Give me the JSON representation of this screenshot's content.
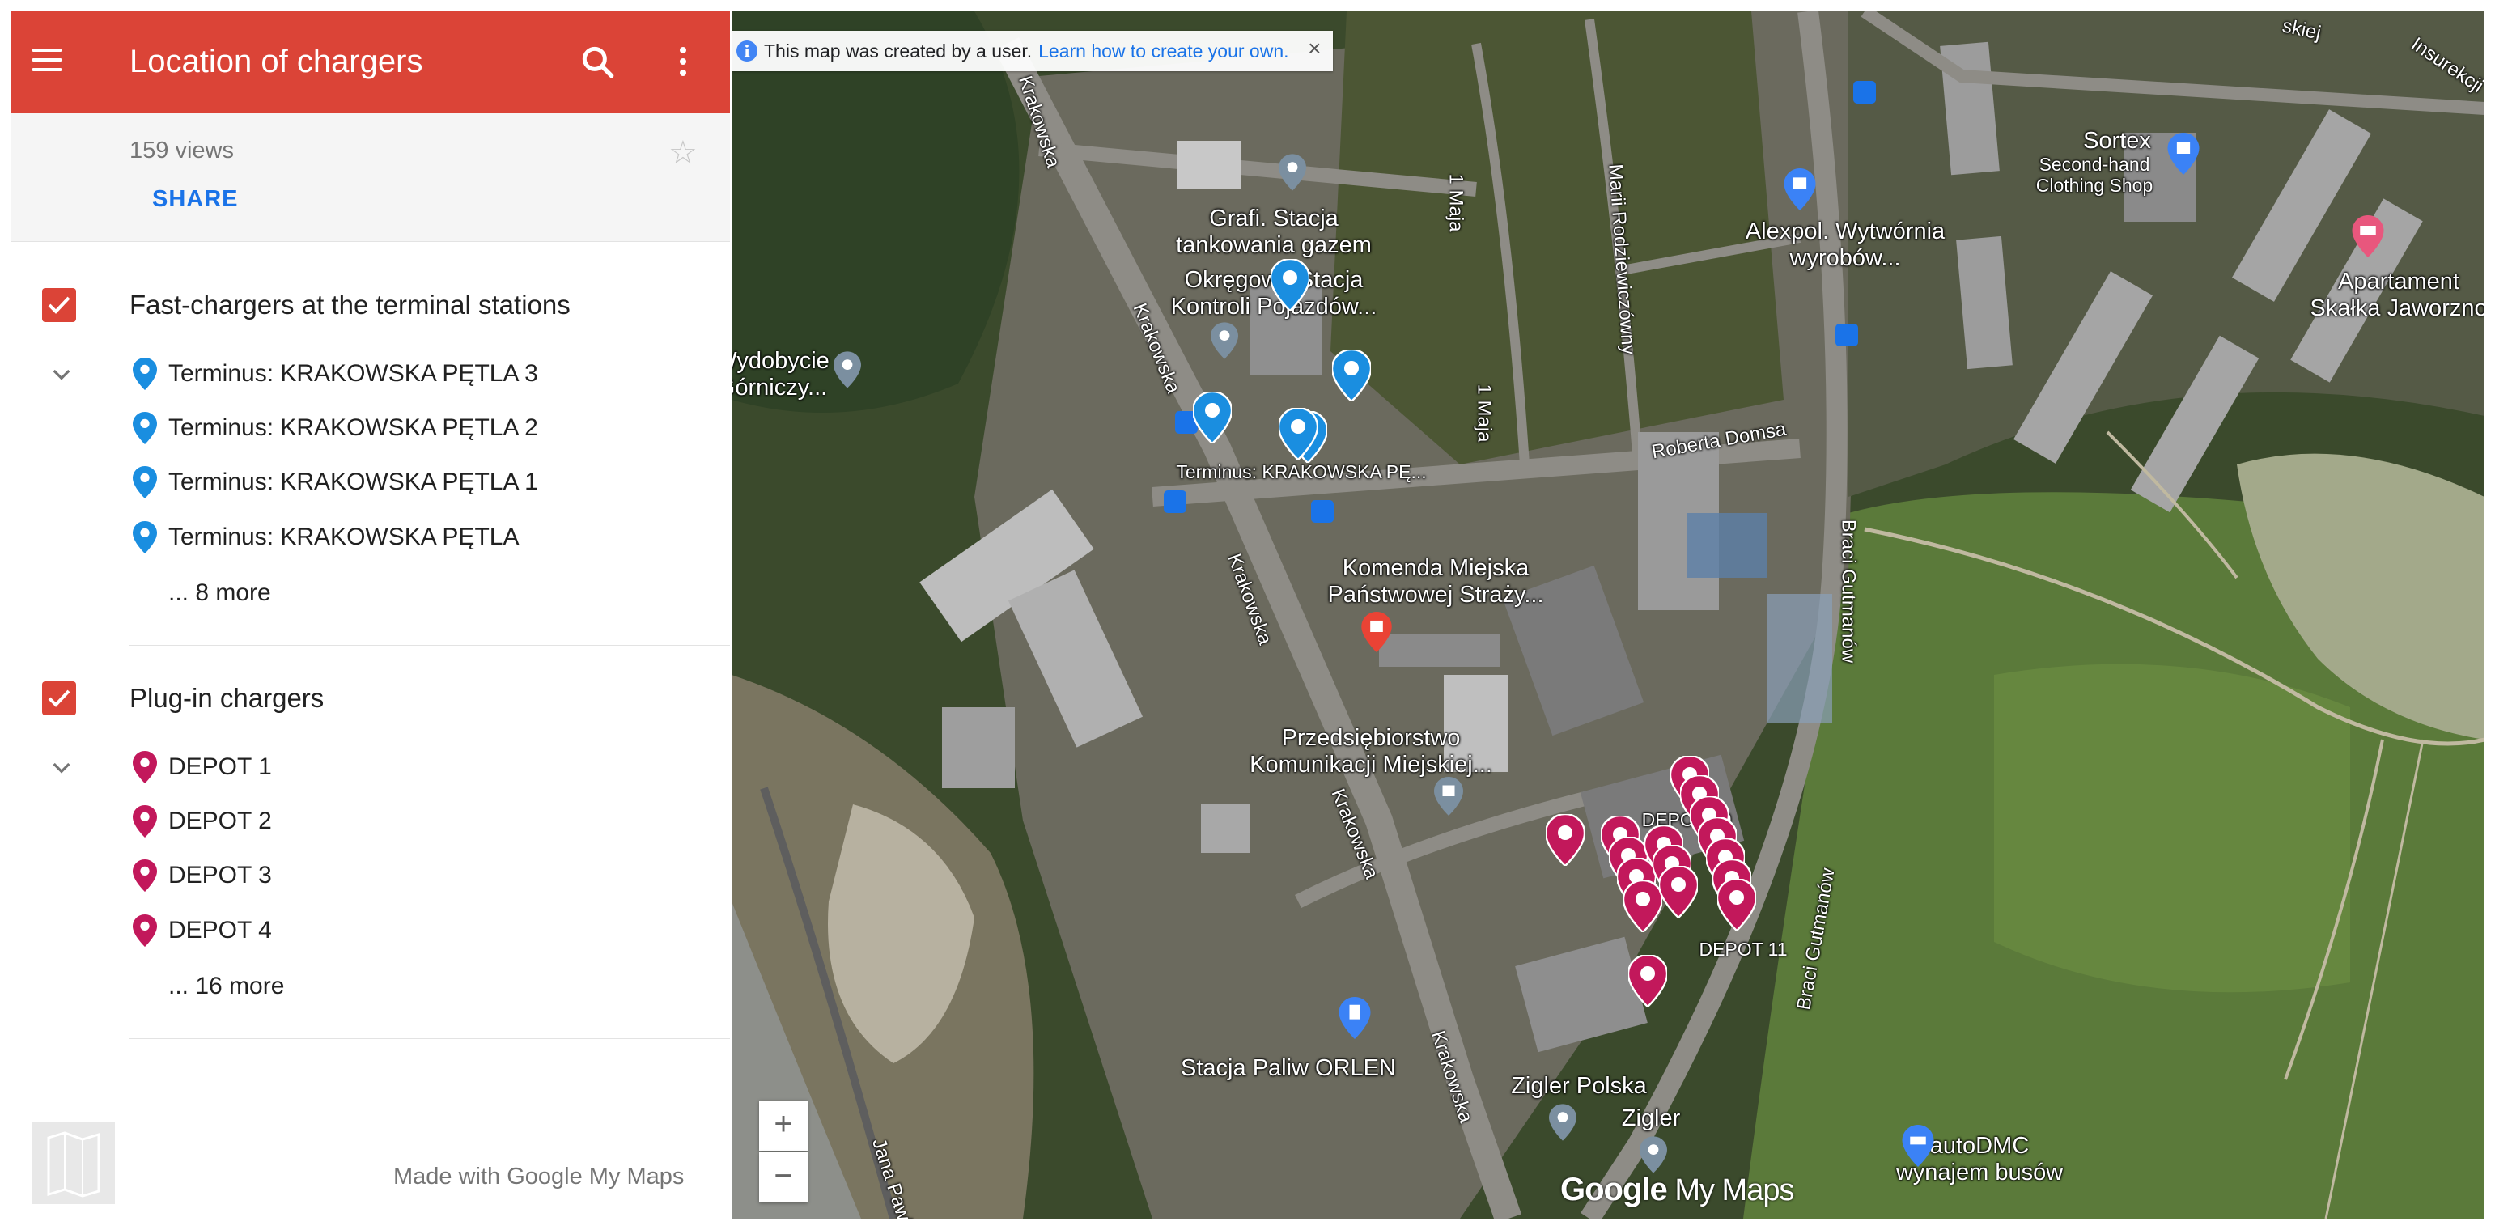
{
  "sidebar": {
    "title": "Location of chargers",
    "views": "159 views",
    "share": "SHARE",
    "layers": [
      {
        "name": "Fast-chargers at the terminal stations",
        "pin_color": "#1a8ee0",
        "items": [
          "Terminus: KRAKOWSKA PĘTLA 3",
          "Terminus: KRAKOWSKA PĘTLA 2",
          "Terminus: KRAKOWSKA PĘTLA 1",
          "Terminus: KRAKOWSKA PĘTLA"
        ],
        "more": "... 8 more"
      },
      {
        "name": "Plug-in chargers",
        "pin_color": "#c2185b",
        "items": [
          "DEPOT 1",
          "DEPOT 2",
          "DEPOT 3",
          "DEPOT 4"
        ],
        "more": "... 16 more"
      }
    ],
    "footer": "Made with Google My Maps",
    "check_color": "#db4437"
  },
  "map": {
    "banner": {
      "text": "This map was created by a user.",
      "link": "Learn how to create your own.",
      "close": "×"
    },
    "place_labels": {
      "grafi": "Grafi. Stacja\ntankowania gazem",
      "okregowa": "Okręgowa Stacja\nKontroli Pojazdów...",
      "wydobycie": "Wydobycie\nGórniczy...",
      "terminus": "Terminus: KRAKOWSKA PĘ...",
      "komenda": "Komenda Miejska\nPaństwowej Straży...",
      "przedsiebiorstwo": "Przedsiębiorstwo\nKomunikacji Miejskiej...",
      "depot20": "DEPOT 20",
      "depot11": "DEPOT 11",
      "orlen": "Stacja Paliw ORLEN",
      "zigler_polska": "Zigler Polska",
      "zigler": "Zigler",
      "alexpol": "Alexpol. Wytwórnia\nwyrobów...",
      "sortex": "Sortex",
      "sortex_sub": "Second-hand\nClothing Shop",
      "apartament": "Apartament\nSkałka Jaworzno",
      "autodmc": "autoDMC\nwynajem busów"
    },
    "road_labels": {
      "krakowska": "Krakowska",
      "majaA": "1 Maja",
      "majaB": "1 Maja",
      "rodziewicz": "Marii Rodziewiczówny",
      "domsa": "Roberta Domsa",
      "gutmanow": "Braci Gutmanów",
      "jana": "Jana Pawła",
      "insurek": "Insurekcji",
      "skiej": "skiej"
    },
    "zoom_in": "+",
    "zoom_out": "−",
    "logo_google": "Google",
    "logo_mymaps": " My Maps",
    "terminal_pin_color": "#1a8ee0",
    "depot_pin_color": "#c2185b"
  }
}
